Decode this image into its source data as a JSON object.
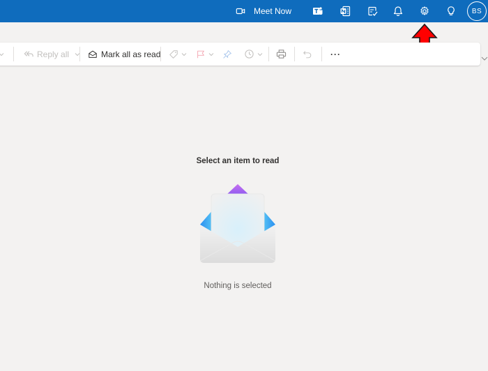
{
  "topbar": {
    "meet_now_label": "Meet Now",
    "avatar_initials": "BS",
    "background_color": "#0f6cbd",
    "icons": [
      "video-camera-icon",
      "teams-icon",
      "onenote-icon",
      "to-do-icon",
      "bell-icon",
      "gear-icon",
      "lightbulb-icon"
    ]
  },
  "toolbar": {
    "reply_all_label": "Reply all",
    "mark_all_read_label": "Mark all as read",
    "more_label": "···",
    "icons": [
      "reply-all-icon",
      "envelope-open-icon",
      "tag-icon",
      "flag-icon",
      "pin-icon",
      "clock-icon",
      "print-icon",
      "undo-icon",
      "more-icon"
    ]
  },
  "reading_pane": {
    "title": "Select an item to read",
    "subtitle": "Nothing is selected"
  },
  "annotation": {
    "arrow_color": "#ff0000",
    "points_to": "gear-icon"
  }
}
